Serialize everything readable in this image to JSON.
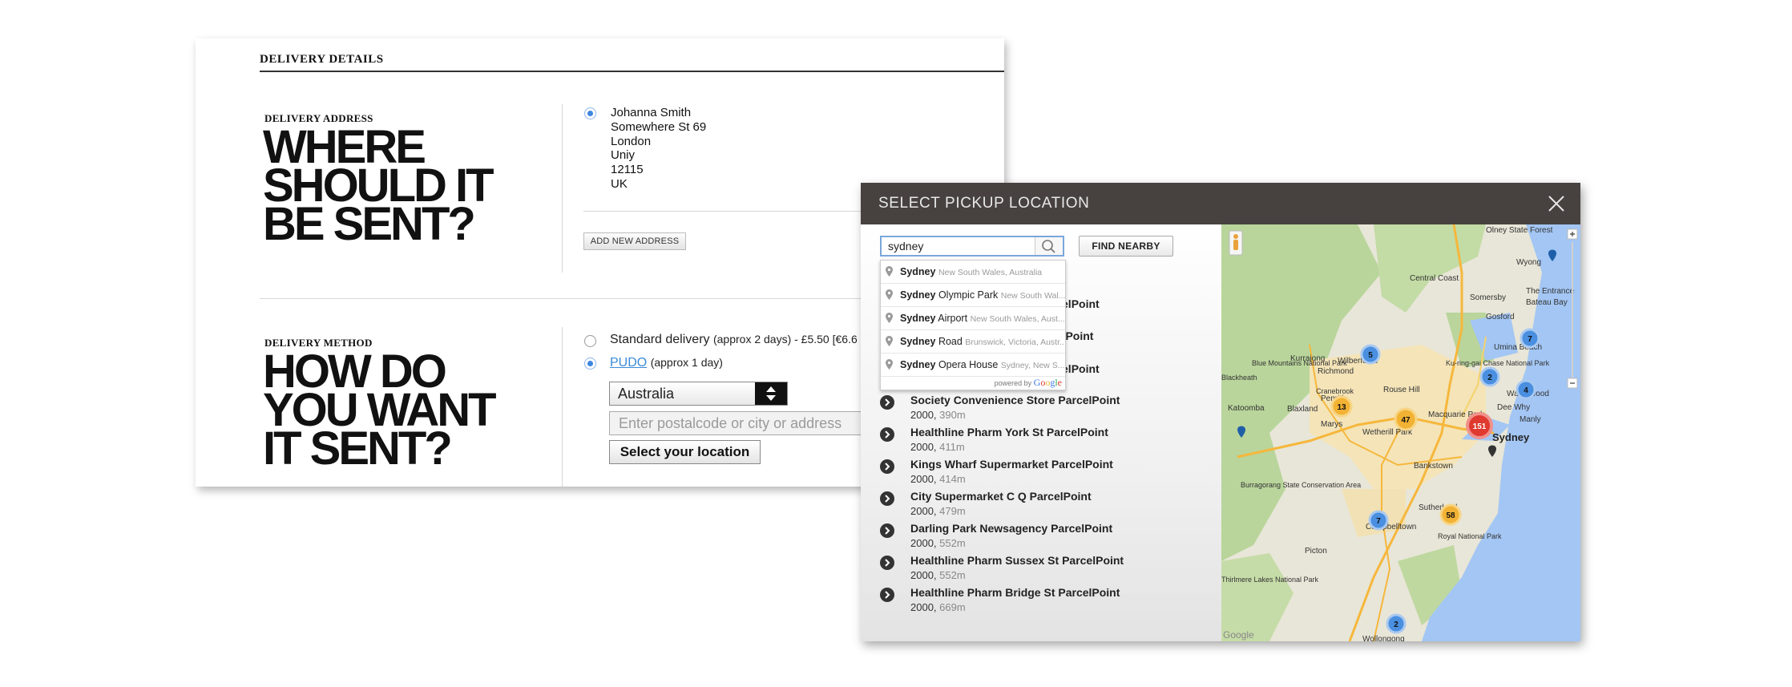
{
  "checkout": {
    "section_title": "DELIVERY DETAILS",
    "address_section": {
      "label": "DELIVERY ADDRESS",
      "heading_lines": [
        "WHERE",
        "SHOULD IT",
        "BE SENT?"
      ],
      "address_lines": [
        "Johanna Smith",
        "Somewhere St 69",
        "London",
        "Uniy",
        "12115",
        "UK"
      ],
      "add_button": "ADD NEW ADDRESS"
    },
    "method_section": {
      "label": "DELIVERY METHOD",
      "heading_lines": [
        "HOW DO",
        "YOU WANT",
        "IT SENT?"
      ],
      "standard_label": "Standard delivery",
      "standard_detail": "(approx 2 days) - £5.50 [€6.6",
      "pudo_label": "PUDO",
      "pudo_detail": "(approx 1 day)",
      "country": "Australia",
      "postal_placeholder": "Enter postalcode or city or address",
      "select_button": "Select your location"
    }
  },
  "modal": {
    "title": "SELECT PICKUP LOCATION",
    "search_value": "sydney",
    "find_nearby": "FIND NEARBY",
    "autocomplete": [
      {
        "bold": "Sydney",
        "rest": "",
        "sub": "New South Wales, Australia"
      },
      {
        "bold": "Sydney",
        "rest": " Olympic Park",
        "sub": "New South Wal..."
      },
      {
        "bold": "Sydney",
        "rest": " Airport",
        "sub": "New South Wales, Aust..."
      },
      {
        "bold": "Sydney",
        "rest": " Road",
        "sub": "Brunswick, Victoria, Austr..."
      },
      {
        "bold": "Sydney",
        "rest": " Opera House",
        "sub": "Sydney, New S..."
      }
    ],
    "powered_by": "powered by",
    "powered_brand": "Google",
    "partial_results": [
      "arcelPoint",
      "celPoint",
      "arcelPoint"
    ],
    "results": [
      {
        "name": "Society Convenience Store ParcelPoint",
        "postcode": "2000",
        "distance": "390m"
      },
      {
        "name": "Healthline Pharm York St ParcelPoint",
        "postcode": "2000",
        "distance": "411m"
      },
      {
        "name": "Kings Wharf Supermarket ParcelPoint",
        "postcode": "2000",
        "distance": "414m"
      },
      {
        "name": "City Supermarket C Q ParcelPoint",
        "postcode": "2000",
        "distance": "479m"
      },
      {
        "name": "Darling Park Newsagency ParcelPoint",
        "postcode": "2000",
        "distance": "552m"
      },
      {
        "name": "Healthline Pharm Sussex St ParcelPoint",
        "postcode": "2000",
        "distance": "552m"
      },
      {
        "name": "Healthline Pharm Bridge St ParcelPoint",
        "postcode": "2000",
        "distance": "669m"
      }
    ]
  },
  "map": {
    "places": [
      "Olney State Forest",
      "Wyong",
      "Central Coast",
      "The Entrance",
      "Bateau Bay",
      "Somersby",
      "Gosford",
      "Umina Beach",
      "Wilberforce",
      "Richmond",
      "Kurrajong",
      "Blue Mountains National Park",
      "Ku-ring-gai Chase National Park",
      "Blackheath",
      "Katoomba",
      "Penrith",
      "Blaxland",
      "Cranebrook",
      "Rouse Hill",
      "Warriewood",
      "Dee Why",
      "Manly",
      "Marys",
      "Wetherill Park",
      "Macquarie Park",
      "Bankstown",
      "Sydney",
      "Sutherland",
      "Burragorang State Conservation Area",
      "Campbelltown",
      "Royal National Park",
      "Picton",
      "Thirlmere Lakes National Park",
      "Wollongong",
      "Google"
    ],
    "clusters": [
      "5",
      "7",
      "2",
      "4",
      "13",
      "47",
      "151",
      "7",
      "58",
      "2"
    ],
    "colors": {
      "water": "#a3c6f4",
      "land": "#e8e6d8",
      "forest": "#b9d59b",
      "urban": "#f4e4b8",
      "road": "#f6b73c",
      "cluster_blue": "#4a8fe0",
      "cluster_yellow": "#f2b233",
      "cluster_red": "#e0392f"
    }
  },
  "icons": [
    "radio-selected-icon",
    "radio-unselected-icon",
    "up-down-arrows-icon",
    "close-icon",
    "search-icon",
    "location-pin-icon",
    "chevron-right-circle-icon",
    "pegman-icon",
    "zoom-in-icon",
    "zoom-out-icon"
  ]
}
